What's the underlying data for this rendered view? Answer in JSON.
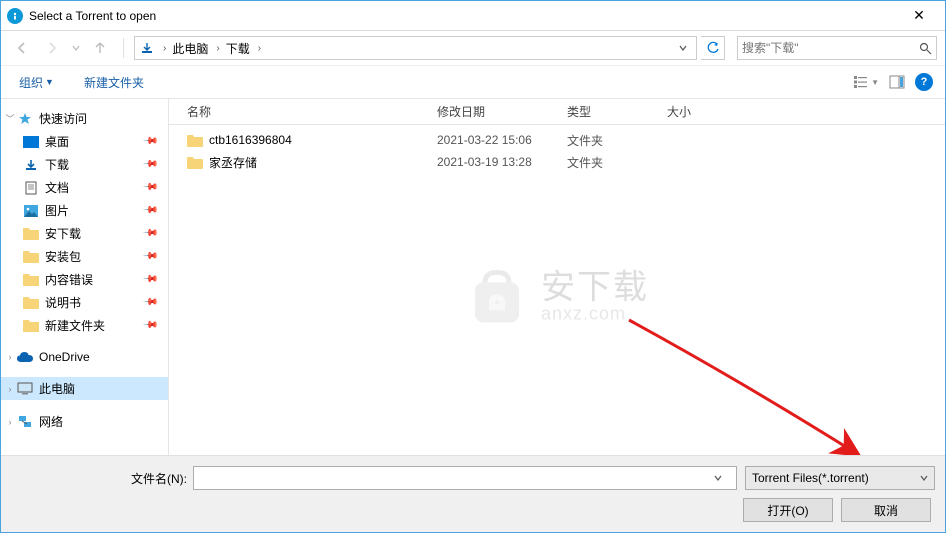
{
  "title": "Select a Torrent to open",
  "breadcrumb": {
    "root": "此电脑",
    "folder": "下载"
  },
  "search": {
    "placeholder": "搜索\"下载\""
  },
  "toolbar": {
    "organize": "组织",
    "newfolder": "新建文件夹"
  },
  "columns": {
    "name": "名称",
    "date": "修改日期",
    "type": "类型",
    "size": "大小"
  },
  "sidebar": {
    "quick": "快速访问",
    "items": [
      {
        "label": "桌面"
      },
      {
        "label": "下载"
      },
      {
        "label": "文档"
      },
      {
        "label": "图片"
      },
      {
        "label": "安下载"
      },
      {
        "label": "安装包"
      },
      {
        "label": "内容错误"
      },
      {
        "label": "说明书"
      },
      {
        "label": "新建文件夹"
      }
    ],
    "onedrive": "OneDrive",
    "thispc": "此电脑",
    "network": "网络"
  },
  "files": [
    {
      "name": "ctb1616396804",
      "date": "2021-03-22 15:06",
      "type": "文件夹"
    },
    {
      "name": "家丞存储",
      "date": "2021-03-19 13:28",
      "type": "文件夹"
    }
  ],
  "watermark": {
    "cn": "安下载",
    "en": "anxz.com"
  },
  "bottom": {
    "filename_label": "文件名(N):",
    "filename_value": "",
    "filetype": "Torrent Files(*.torrent)",
    "open": "打开(O)",
    "cancel": "取消"
  }
}
